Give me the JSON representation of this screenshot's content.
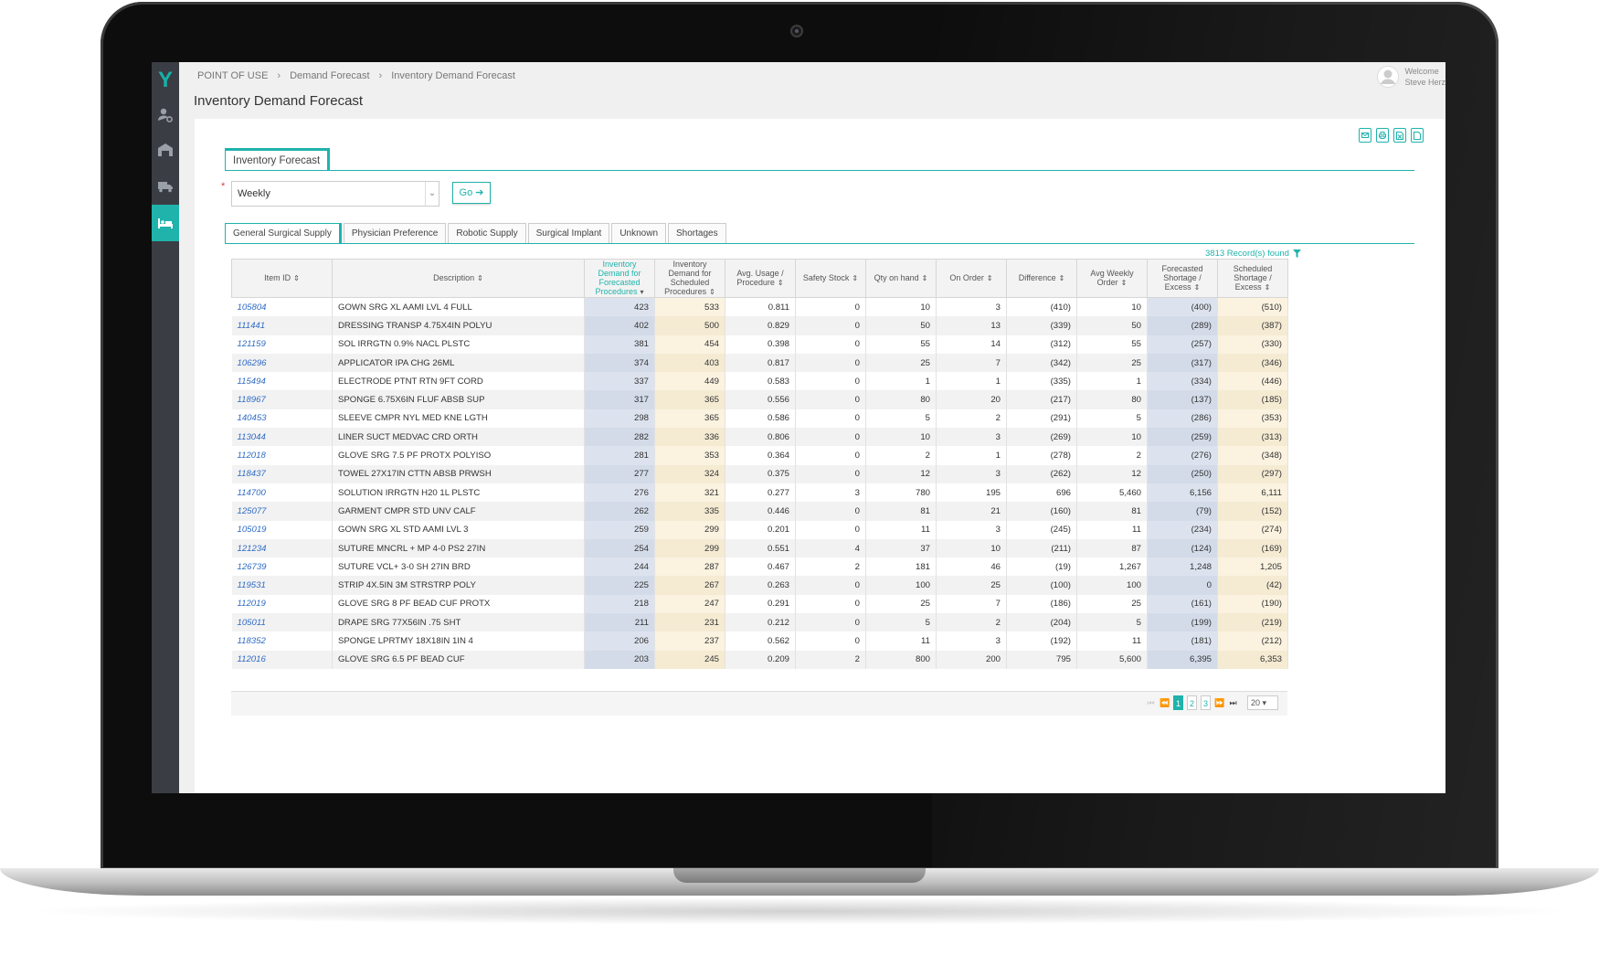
{
  "breadcrumb": [
    "POINT OF USE",
    "Demand Forecast",
    "Inventory Demand Forecast"
  ],
  "page_title": "Inventory Demand Forecast",
  "user": {
    "welcome": "Welcome",
    "name": "Steve Herz"
  },
  "outer_tab": "Inventory Forecast",
  "filter": {
    "required_mark": "*",
    "period_value": "Weekly",
    "go_label": "Go ➔"
  },
  "tabs": [
    "General Surgical Supply",
    "Physician Preference",
    "Robotic Supply",
    "Surgical Implant",
    "Unknown",
    "Shortages"
  ],
  "records_found": "3813 Record(s) found",
  "columns": [
    "Item ID",
    "Description",
    "Inventory Demand for Forecasted Procedures",
    "Inventory Demand for Scheduled Procedures",
    "Avg. Usage / Procedure",
    "Safety Stock",
    "Qty on hand",
    "On Order",
    "Difference",
    "Avg Weekly Order",
    "Forecasted Shortage / Excess",
    "Scheduled Shortage / Excess"
  ],
  "rows": [
    [
      "105804",
      "GOWN SRG XL AAMI LVL 4 FULL",
      "423",
      "533",
      "0.811",
      "0",
      "10",
      "3",
      "(410)",
      "10",
      "(400)",
      "(510)"
    ],
    [
      "111441",
      "DRESSING TRANSP 4.75X4IN POLYU",
      "402",
      "500",
      "0.829",
      "0",
      "50",
      "13",
      "(339)",
      "50",
      "(289)",
      "(387)"
    ],
    [
      "121159",
      "SOL IRRGTN 0.9% NACL PLSTC",
      "381",
      "454",
      "0.398",
      "0",
      "55",
      "14",
      "(312)",
      "55",
      "(257)",
      "(330)"
    ],
    [
      "106296",
      "APPLICATOR IPA CHG 26ML",
      "374",
      "403",
      "0.817",
      "0",
      "25",
      "7",
      "(342)",
      "25",
      "(317)",
      "(346)"
    ],
    [
      "115494",
      "ELECTRODE PTNT RTN 9FT CORD",
      "337",
      "449",
      "0.583",
      "0",
      "1",
      "1",
      "(335)",
      "1",
      "(334)",
      "(446)"
    ],
    [
      "118967",
      "SPONGE 6.75X6IN FLUF ABSB SUP",
      "317",
      "365",
      "0.556",
      "0",
      "80",
      "20",
      "(217)",
      "80",
      "(137)",
      "(185)"
    ],
    [
      "140453",
      "SLEEVE CMPR NYL MED KNE LGTH",
      "298",
      "365",
      "0.586",
      "0",
      "5",
      "2",
      "(291)",
      "5",
      "(286)",
      "(353)"
    ],
    [
      "113044",
      "LINER SUCT MEDVAC CRD ORTH",
      "282",
      "336",
      "0.806",
      "0",
      "10",
      "3",
      "(269)",
      "10",
      "(259)",
      "(313)"
    ],
    [
      "112018",
      "GLOVE SRG 7.5 PF PROTX POLYISO",
      "281",
      "353",
      "0.364",
      "0",
      "2",
      "1",
      "(278)",
      "2",
      "(276)",
      "(348)"
    ],
    [
      "118437",
      "TOWEL 27X17IN CTTN ABSB PRWSH",
      "277",
      "324",
      "0.375",
      "0",
      "12",
      "3",
      "(262)",
      "12",
      "(250)",
      "(297)"
    ],
    [
      "114700",
      "SOLUTION IRRGTN H20 1L PLSTC",
      "276",
      "321",
      "0.277",
      "3",
      "780",
      "195",
      "696",
      "5,460",
      "6,156",
      "6,111"
    ],
    [
      "125077",
      "GARMENT CMPR STD UNV CALF",
      "262",
      "335",
      "0.446",
      "0",
      "81",
      "21",
      "(160)",
      "81",
      "(79)",
      "(152)"
    ],
    [
      "105019",
      "GOWN SRG XL STD AAMI LVL 3",
      "259",
      "299",
      "0.201",
      "0",
      "11",
      "3",
      "(245)",
      "11",
      "(234)",
      "(274)"
    ],
    [
      "121234",
      "SUTURE MNCRL + MP 4-0 PS2 27IN",
      "254",
      "299",
      "0.551",
      "4",
      "37",
      "10",
      "(211)",
      "87",
      "(124)",
      "(169)"
    ],
    [
      "126739",
      "SUTURE VCL+ 3-0 SH 27IN BRD",
      "244",
      "287",
      "0.467",
      "2",
      "181",
      "46",
      "(19)",
      "1,267",
      "1,248",
      "1,205"
    ],
    [
      "119531",
      "STRIP 4X.5IN 3M STRSTRP POLY",
      "225",
      "267",
      "0.263",
      "0",
      "100",
      "25",
      "(100)",
      "100",
      "0",
      "(42)"
    ],
    [
      "112019",
      "GLOVE SRG 8 PF BEAD CUF PROTX",
      "218",
      "247",
      "0.291",
      "0",
      "25",
      "7",
      "(186)",
      "25",
      "(161)",
      "(190)"
    ],
    [
      "105011",
      "DRAPE SRG 77X56IN .75 SHT",
      "211",
      "231",
      "0.212",
      "0",
      "5",
      "2",
      "(204)",
      "5",
      "(199)",
      "(219)"
    ],
    [
      "118352",
      "SPONGE LPRTMY 18X18IN 1IN 4",
      "206",
      "237",
      "0.562",
      "0",
      "11",
      "3",
      "(192)",
      "11",
      "(181)",
      "(212)"
    ],
    [
      "112016",
      "GLOVE SRG 6.5 PF BEAD CUF",
      "203",
      "245",
      "0.209",
      "2",
      "800",
      "200",
      "795",
      "5,600",
      "6,395",
      "6,353"
    ]
  ],
  "pager": {
    "pages": [
      "1",
      "2",
      "3"
    ],
    "page_size": "20"
  },
  "colors": {
    "accent": "#1fb3ab",
    "sidebar": "#3a3d43",
    "link": "#2e6bc5",
    "forecast_col": "#dde3ee",
    "scheduled_col": "#fbf3e0"
  }
}
